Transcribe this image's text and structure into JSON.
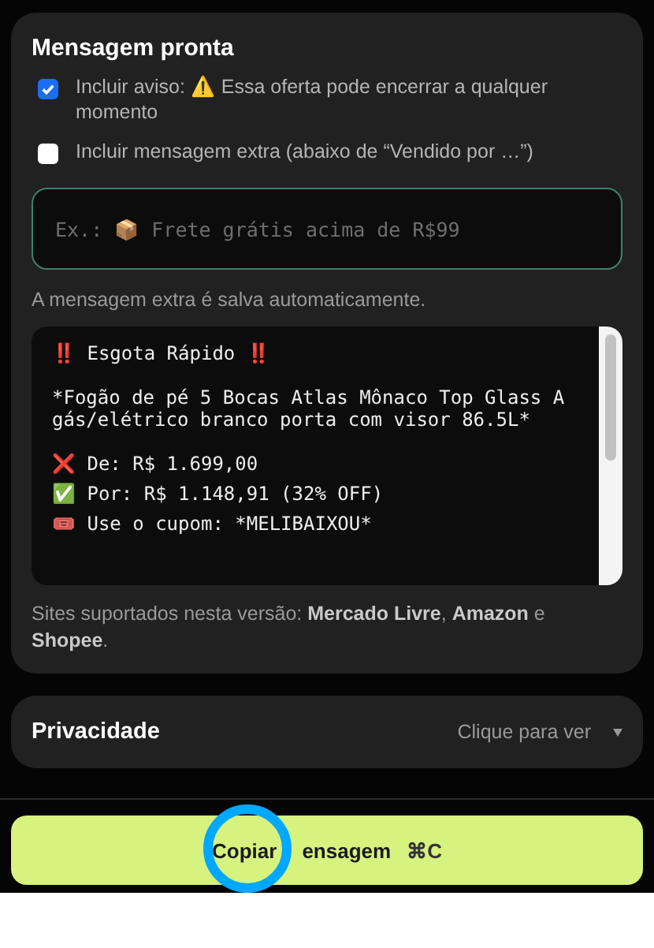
{
  "message_card": {
    "title": "Mensagem pronta",
    "options": [
      {
        "label": "Incluir aviso: ⚠️ Essa oferta pode encerrar a qualquer momento",
        "checked": true
      },
      {
        "label": "Incluir mensagem extra (abaixo de “Vendido por …”)",
        "checked": false
      }
    ],
    "extra_field": {
      "placeholder": "Ex.: 📦 Frete grátis acima de R$99"
    },
    "extra_hint": "A mensagem extra é salva automaticamente.",
    "preview_paragraphs": [
      [
        "‼️ Esgota Rápido ‼️"
      ],
      [
        "*Fogão de pé 5 Bocas Atlas Mônaco Top Glass A gás/elétrico branco porta com visor 86.5L*"
      ],
      [
        "❌ De: R$ 1.699,00",
        "✅ Por: R$ 1.148,91 (32% OFF)",
        "🎟️ Use o cupom: *MELIBAIXOU*"
      ]
    ],
    "supported_sites": "Sites suportados nesta versão: **Mercado Livre**, **Amazon** e **Shopee**."
  },
  "privacy": {
    "title": "Privacidade",
    "action": "Clique para ver",
    "expanded": false
  },
  "copy_button": {
    "label_visible_parts": [
      "Copiar",
      "ensagem"
    ],
    "shortcut": "⌘C"
  }
}
